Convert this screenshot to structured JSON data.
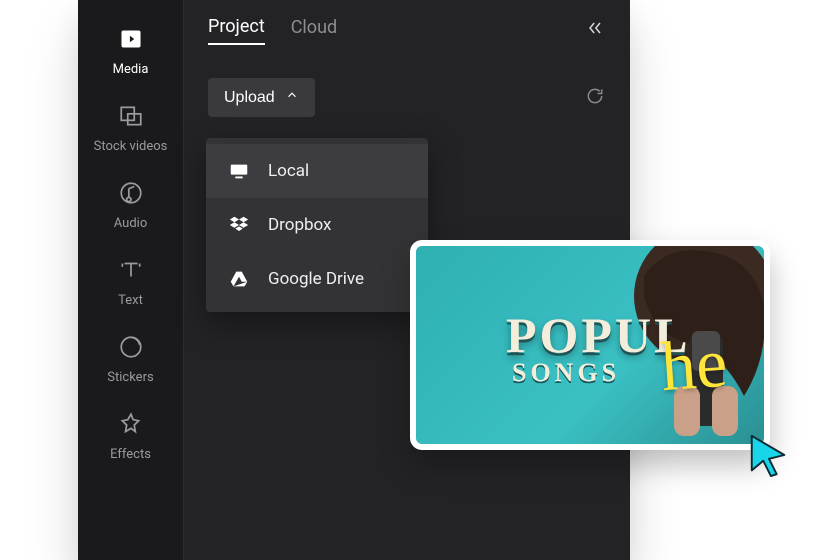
{
  "sidebar": {
    "items": [
      {
        "label": "Media"
      },
      {
        "label": "Stock videos"
      },
      {
        "label": "Audio"
      },
      {
        "label": "Text"
      },
      {
        "label": "Stickers"
      },
      {
        "label": "Effects"
      }
    ]
  },
  "tabs": {
    "project": "Project",
    "cloud": "Cloud"
  },
  "upload": {
    "label": "Upload",
    "options": [
      {
        "label": "Local"
      },
      {
        "label": "Dropbox"
      },
      {
        "label": "Google Drive"
      }
    ]
  },
  "preview": {
    "title_main": "POPUL",
    "title_sub": "SONGS",
    "title_script": "he"
  }
}
